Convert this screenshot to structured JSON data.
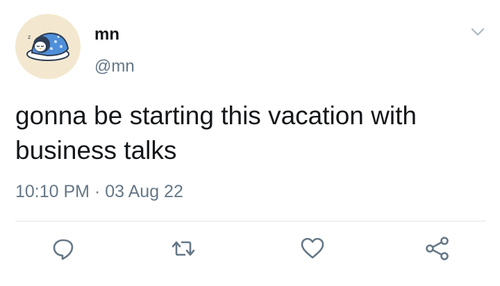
{
  "tweet": {
    "author": {
      "display_name": "mn",
      "handle": "@mn",
      "avatar_icon": "sleeping-penguin-avatar"
    },
    "text": "gonna be starting this vacation with business talks",
    "time": "10:10 PM",
    "separator": "·",
    "date": "03 Aug 22",
    "actions": [
      {
        "name": "reply",
        "icon": "reply-icon"
      },
      {
        "name": "retweet",
        "icon": "retweet-icon"
      },
      {
        "name": "like",
        "icon": "heart-icon"
      },
      {
        "name": "share",
        "icon": "share-icon"
      }
    ],
    "colors": {
      "text": "#14171a",
      "secondary": "#657786",
      "divider": "#e1e8ed",
      "avatar_bg": "#f3e8cf"
    }
  }
}
